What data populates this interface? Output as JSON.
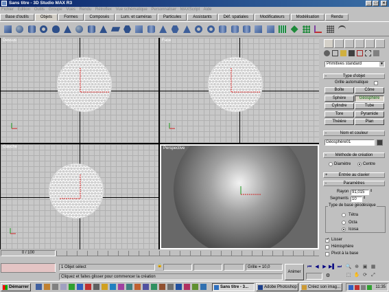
{
  "window": {
    "title": "Sans titre - 3D Studio MAX R3"
  },
  "menubar": [
    "Fichier",
    "Edition",
    "Outils",
    "Groupe",
    "Vues",
    "Rendu",
    "Rétroflex",
    "Vue schématique",
    "Personnaliser",
    "MAXScript",
    "Aide"
  ],
  "tabs": [
    {
      "label": "Base d'outils",
      "active": false
    },
    {
      "label": "Objets",
      "active": true
    },
    {
      "label": "Formes",
      "active": false
    },
    {
      "label": "Composés",
      "active": false
    },
    {
      "label": "Lum. et caméras",
      "active": false
    },
    {
      "label": "Particules",
      "active": false
    },
    {
      "label": "Assistants",
      "active": false
    },
    {
      "label": "Déf. spatiales",
      "active": false
    },
    {
      "label": "Modificateurs",
      "active": false
    },
    {
      "label": "Modélisation",
      "active": false
    },
    {
      "label": "Rendu",
      "active": false
    }
  ],
  "toolbar": {
    "icons": [
      "box-icon",
      "sphere-icon",
      "cylinder-icon",
      "torus-icon",
      "teapot-icon",
      "cone-icon",
      "geosphere-icon",
      "tube-icon",
      "pyramid-icon",
      "plane-icon",
      "hedra-icon",
      "chamfer-box-icon",
      "oiltank-icon",
      "spindle-icon",
      "gengon-icon",
      "prism-icon",
      "torus-knot-icon",
      "ringwave-icon",
      "hose-icon",
      "capsule-icon",
      "chamfer-cyl-icon",
      "l-ext-icon",
      "c-ext-icon",
      "grid-icon",
      "diamond-icon",
      "dots-icon",
      "pick-icon",
      "spray-icon",
      "wave-icon"
    ],
    "colors": [
      "#2d4f8a",
      "#2d4f8a",
      "#2d4f8a",
      "#2d4f8a",
      "#2d4f8a",
      "#2d4f8a",
      "#2d4f8a",
      "#2d4f8a",
      "#2d4f8a",
      "#2d4f8a",
      "#2d4f8a",
      "#3d5f9a",
      "#3d5f9a",
      "#3d5f9a",
      "#3d5f9a",
      "#3d5f9a",
      "#3d5f9a",
      "#3d5f9a",
      "#3d5f9a",
      "#3d5f9a",
      "#3d5f9a",
      "#3d5f9a",
      "#3d5f9a",
      "#1e8a3a",
      "#1e8a3a",
      "#1e8a3a",
      "#8040a0",
      "#404040",
      "#404040"
    ]
  },
  "viewports": {
    "top": "Dessus",
    "front": "Face",
    "left": "Gauche",
    "perspective": "Perspective"
  },
  "panel": {
    "dropdown": "Primitives standard",
    "object_type": {
      "title": "Type d'objet",
      "autogrid_label": "Grille automatique",
      "buttons": [
        "Boîte",
        "Cône",
        "Sphère",
        "Géosphère",
        "Cylindre",
        "Tube",
        "Tore",
        "Pyramide",
        "Théière",
        "Plan"
      ],
      "active": "Géosphère"
    },
    "name_color": {
      "title": "Nom et couleur",
      "name_value": "Géosphère01",
      "color": "#404040"
    },
    "creation_method": {
      "title": "Méthode de création",
      "diameter": "Diamètre",
      "center": "Centre"
    },
    "keyboard_entry": {
      "title": "Entrée au clavier"
    },
    "parameters": {
      "title": "Paramètres",
      "radius_label": "Rayon",
      "radius_value": "91,015",
      "segments_label": "Segments",
      "segments_value": "10",
      "group_label": "Type de base géodésique",
      "tetra": "Tétra",
      "octa": "Octa",
      "icosa": "Icosa",
      "smooth": "Lisser",
      "hemisphere": "Hémisphère",
      "base_pivot": "Pivot à la base"
    }
  },
  "timebar": {
    "slider": "0 / 100"
  },
  "status": {
    "selection": "1 Objet sélect",
    "prompt": "Cliquez et faites glisser pour commencer la création",
    "grid": "Grille = 10,0",
    "animate": "Animer"
  },
  "taskbar": {
    "start": "Démarrer",
    "tasks": [
      {
        "label": "Sans titre - 3...",
        "active": true,
        "color": "#2d6fbf"
      },
      {
        "label": "Adobe Photoshop",
        "active": false,
        "color": "#1c3f8a"
      },
      {
        "label": "Créez son imag...",
        "active": false,
        "color": "#cc9933"
      }
    ],
    "clock": "11:35"
  }
}
